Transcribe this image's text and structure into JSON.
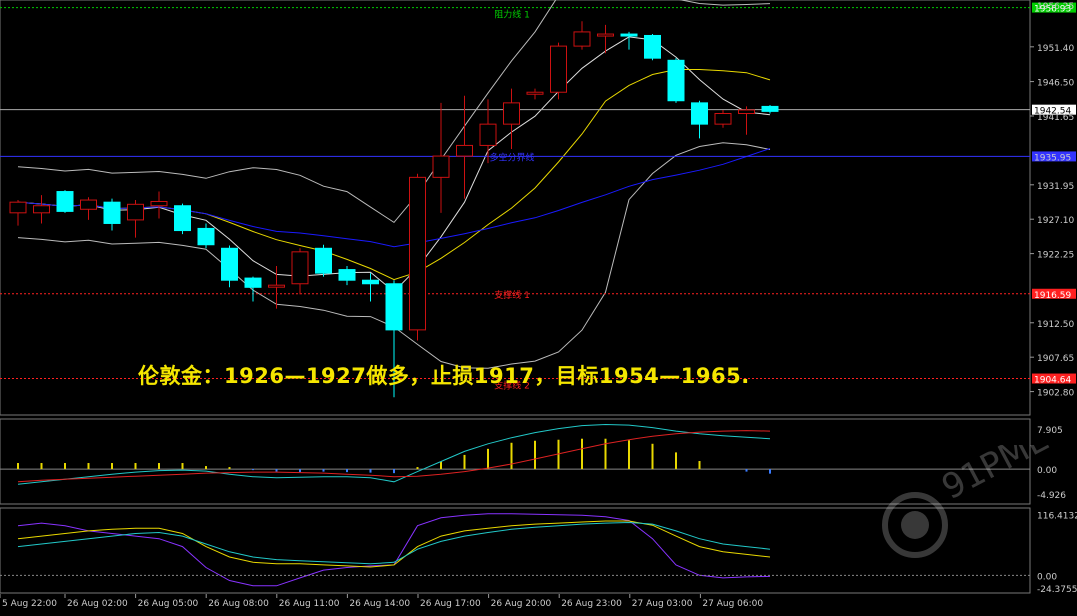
{
  "chart_data": {
    "type": "candlestick",
    "instrument_note": "伦敦金：1926—1927做多，止损1917，目标1954—1965.",
    "colors": {
      "bull": "#cc1111",
      "bear": "#00ffff",
      "background": "#000000",
      "bb_band": "#bbbbbb",
      "ma_yellow": "#e8d800",
      "ma_blue": "#1a1aff",
      "resistance": "#00cc00",
      "support": "#ff2020",
      "pivot": "#3333ff"
    },
    "x_ticks": [
      "5 Aug 22:00",
      "26 Aug 02:00",
      "26 Aug 05:00",
      "26 Aug 08:00",
      "26 Aug 11:00",
      "26 Aug 14:00",
      "26 Aug 17:00",
      "26 Aug 20:00",
      "26 Aug 23:00",
      "27 Aug 03:00",
      "27 Aug 06:00"
    ],
    "y_ticks": [
      "1951.40",
      "1946.50",
      "1941.65",
      "1931.95",
      "1927.10",
      "1922.25",
      "1912.50",
      "1907.65",
      "1902.80"
    ],
    "ylim": [
      1899.5,
      1958.0
    ],
    "candles": [
      {
        "o": 1928.0,
        "h": 1929.8,
        "l": 1926.2,
        "c": 1929.5
      },
      {
        "o": 1928.0,
        "h": 1930.5,
        "l": 1926.5,
        "c": 1929.0
      },
      {
        "o": 1931.0,
        "h": 1931.2,
        "l": 1928.0,
        "c": 1928.2
      },
      {
        "o": 1928.5,
        "h": 1930.2,
        "l": 1927.0,
        "c": 1929.8
      },
      {
        "o": 1929.5,
        "h": 1930.0,
        "l": 1925.5,
        "c": 1926.5
      },
      {
        "o": 1927.0,
        "h": 1929.8,
        "l": 1924.5,
        "c": 1929.2
      },
      {
        "o": 1929.0,
        "h": 1931.0,
        "l": 1927.2,
        "c": 1929.6
      },
      {
        "o": 1929.0,
        "h": 1929.3,
        "l": 1925.0,
        "c": 1925.5
      },
      {
        "o": 1925.8,
        "h": 1926.5,
        "l": 1923.0,
        "c": 1923.5
      },
      {
        "o": 1923.0,
        "h": 1923.4,
        "l": 1917.5,
        "c": 1918.5
      },
      {
        "o": 1918.8,
        "h": 1919.0,
        "l": 1915.5,
        "c": 1917.5
      },
      {
        "o": 1917.8,
        "h": 1920.5,
        "l": 1914.5,
        "c": 1917.8
      },
      {
        "o": 1918.0,
        "h": 1923.0,
        "l": 1916.5,
        "c": 1922.5
      },
      {
        "o": 1923.0,
        "h": 1923.5,
        "l": 1919.0,
        "c": 1919.5
      },
      {
        "o": 1920.0,
        "h": 1920.5,
        "l": 1917.8,
        "c": 1918.5
      },
      {
        "o": 1918.5,
        "h": 1919.5,
        "l": 1915.5,
        "c": 1918.0
      },
      {
        "o": 1918.0,
        "h": 1918.5,
        "l": 1902.0,
        "c": 1911.5
      },
      {
        "o": 1911.5,
        "h": 1933.5,
        "l": 1910.0,
        "c": 1933.0
      },
      {
        "o": 1933.0,
        "h": 1943.5,
        "l": 1928.0,
        "c": 1936.0
      },
      {
        "o": 1936.0,
        "h": 1944.5,
        "l": 1930.0,
        "c": 1937.5
      },
      {
        "o": 1937.5,
        "h": 1944.0,
        "l": 1935.0,
        "c": 1940.5
      },
      {
        "o": 1940.5,
        "h": 1945.5,
        "l": 1937.0,
        "c": 1943.5
      },
      {
        "o": 1945.0,
        "h": 1945.5,
        "l": 1944.0,
        "c": 1945.0
      },
      {
        "o": 1945.0,
        "h": 1952.0,
        "l": 1944.0,
        "c": 1951.5
      },
      {
        "o": 1951.5,
        "h": 1955.0,
        "l": 1951.0,
        "c": 1953.5
      },
      {
        "o": 1953.0,
        "h": 1954.5,
        "l": 1950.5,
        "c": 1953.2
      },
      {
        "o": 1953.2,
        "h": 1953.5,
        "l": 1951.0,
        "c": 1953.0
      },
      {
        "o": 1953.0,
        "h": 1953.2,
        "l": 1949.5,
        "c": 1949.8
      },
      {
        "o": 1949.5,
        "h": 1949.8,
        "l": 1943.5,
        "c": 1943.8
      },
      {
        "o": 1943.5,
        "h": 1943.8,
        "l": 1938.5,
        "c": 1940.5
      },
      {
        "o": 1940.5,
        "h": 1942.5,
        "l": 1940.0,
        "c": 1942.0
      },
      {
        "o": 1942.0,
        "h": 1943.0,
        "l": 1939.0,
        "c": 1942.5
      },
      {
        "o": 1943.0,
        "h": 1943.2,
        "l": 1942.0,
        "c": 1942.3
      }
    ],
    "horizontal_lines": [
      {
        "label": "阻力线 1",
        "price": "1956.93",
        "value": 1956.93,
        "color": "#00cc00"
      },
      {
        "label": "多空分界线",
        "price": "1935.95",
        "value": 1935.95,
        "color": "#3333ff"
      },
      {
        "label": "支撑线 1",
        "price": "1916.59",
        "value": 1916.59,
        "color": "#ff2020"
      },
      {
        "label": "支撑线 2",
        "price": "1904.64",
        "value": 1904.64,
        "color": "#ff2020"
      }
    ],
    "current_price": "1942.54",
    "current_price_value": 1942.54,
    "macd": {
      "ticks": [
        "7.905",
        "0.00",
        "-4.926"
      ],
      "ylim": [
        -6.5,
        9.5
      ],
      "hist": [
        1.2,
        1.2,
        1.2,
        1.2,
        1.2,
        1.2,
        1.2,
        1.2,
        0.6,
        0.4,
        -0.2,
        -0.5,
        -0.6,
        -0.5,
        -0.6,
        -0.7,
        -0.8,
        0.4,
        1.5,
        2.8,
        4.0,
        5.2,
        5.6,
        5.8,
        6.0,
        6.0,
        5.7,
        5.0,
        3.3,
        1.6,
        0.0,
        -0.5,
        -0.9,
        -2.1
      ],
      "signal": [
        -2.5,
        -2.2,
        -2.0,
        -1.8,
        -1.6,
        -1.4,
        -1.2,
        -1.0,
        -0.8,
        -0.7,
        -0.6,
        -0.6,
        -0.7,
        -0.8,
        -1.0,
        -1.2,
        -1.5,
        -1.4,
        -1.0,
        -0.5,
        0.2,
        1.0,
        2.0,
        3.0,
        4.0,
        5.0,
        5.8,
        6.5,
        7.0,
        7.3,
        7.5,
        7.6,
        7.5,
        7.3
      ],
      "main": [
        -3.0,
        -2.5,
        -2.0,
        -1.5,
        -1.0,
        -0.6,
        -0.3,
        -0.2,
        -0.4,
        -1.0,
        -1.5,
        -1.7,
        -1.6,
        -1.5,
        -1.5,
        -1.7,
        -2.5,
        -0.5,
        1.5,
        3.5,
        5.0,
        6.2,
        7.2,
        8.0,
        8.6,
        8.8,
        8.7,
        8.2,
        7.5,
        7.0,
        6.6,
        6.3,
        6.0,
        5.5
      ]
    },
    "osc": {
      "ticks": [
        "116.4132",
        "0.00",
        "-24.3755"
      ],
      "ylim": [
        -30,
        125
      ],
      "purple": [
        95,
        100,
        95,
        85,
        80,
        75,
        70,
        55,
        15,
        -10,
        -20,
        -20,
        -5,
        10,
        15,
        18,
        20,
        95,
        110,
        115,
        118,
        118,
        117,
        116,
        115,
        112,
        105,
        70,
        20,
        0,
        -5,
        -3,
        -2
      ],
      "yellow": [
        70,
        75,
        80,
        85,
        88,
        90,
        90,
        80,
        55,
        35,
        25,
        22,
        22,
        20,
        18,
        16,
        20,
        55,
        75,
        85,
        90,
        95,
        98,
        100,
        102,
        104,
        104,
        96,
        75,
        55,
        45,
        40,
        35
      ],
      "cyan": [
        55,
        60,
        65,
        70,
        75,
        80,
        82,
        75,
        60,
        45,
        35,
        30,
        28,
        26,
        24,
        22,
        25,
        50,
        65,
        75,
        82,
        88,
        92,
        95,
        98,
        100,
        101,
        98,
        85,
        70,
        60,
        55,
        50
      ]
    }
  }
}
